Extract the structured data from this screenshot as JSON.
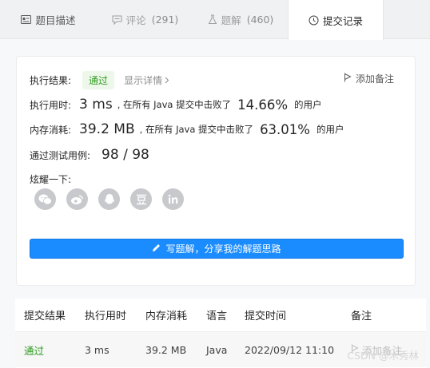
{
  "tabs": [
    {
      "label": "题目描述",
      "count": "",
      "icon": "document-icon"
    },
    {
      "label": "评论",
      "count": "(291)",
      "icon": "comment-icon"
    },
    {
      "label": "题解",
      "count": "(460)",
      "icon": "flask-icon"
    },
    {
      "label": "提交记录",
      "count": "",
      "icon": "clock-icon"
    }
  ],
  "result": {
    "label": "执行结果:",
    "status": "通过",
    "detail_link": "显示详情",
    "add_note": "添加备注"
  },
  "runtime": {
    "label": "执行用时:",
    "value": "3 ms",
    "text_before": ", 在所有 Java 提交中击败了",
    "percent": "14.66%",
    "text_after": "的用户"
  },
  "memory": {
    "label": "内存消耗:",
    "value": "39.2 MB",
    "text_before": ", 在所有 Java 提交中击败了",
    "percent": "63.01%",
    "text_after": "的用户"
  },
  "testcases": {
    "label": "通过测试用例:",
    "value": "98 / 98"
  },
  "share": {
    "label": "炫耀一下:",
    "icons": [
      "wechat-icon",
      "weibo-icon",
      "qq-icon",
      "douban-icon",
      "linkedin-icon"
    ]
  },
  "write_solution": "写题解，分享我的解题思路",
  "table": {
    "headers": [
      "提交结果",
      "执行用时",
      "内存消耗",
      "语言",
      "提交时间",
      "备注"
    ],
    "rows": [
      {
        "status": "通过",
        "runtime": "3 ms",
        "memory": "39.2 MB",
        "language": "Java",
        "time": "2022/09/12 11:10",
        "note": "添加备注"
      }
    ]
  },
  "watermark": "CSDN @木秀林",
  "colors": {
    "accent": "#1a8cff",
    "success": "#2e9b1e",
    "muted": "#8c8c8c"
  }
}
